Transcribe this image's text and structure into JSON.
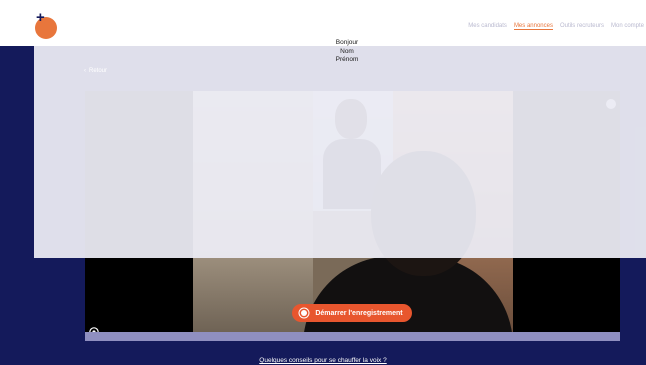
{
  "greeting": {
    "line1": "Bonjour",
    "line2": "Nom",
    "line3": "Prénom"
  },
  "nav": {
    "items": [
      "Mes candidats",
      "Mes annonces",
      "Outils recruteurs",
      "Mon compte"
    ],
    "active": "Mes annonces"
  },
  "back": {
    "label": "Retour"
  },
  "recorder": {
    "record_label": "Démarrer l'enregistrement"
  },
  "footer": {
    "tips_link": "Quelques conseils pour se chauffer la voix ?"
  },
  "colors": {
    "navy": "#141a5b",
    "accent": "#e8562e",
    "timeline": "#8f8fc0"
  }
}
